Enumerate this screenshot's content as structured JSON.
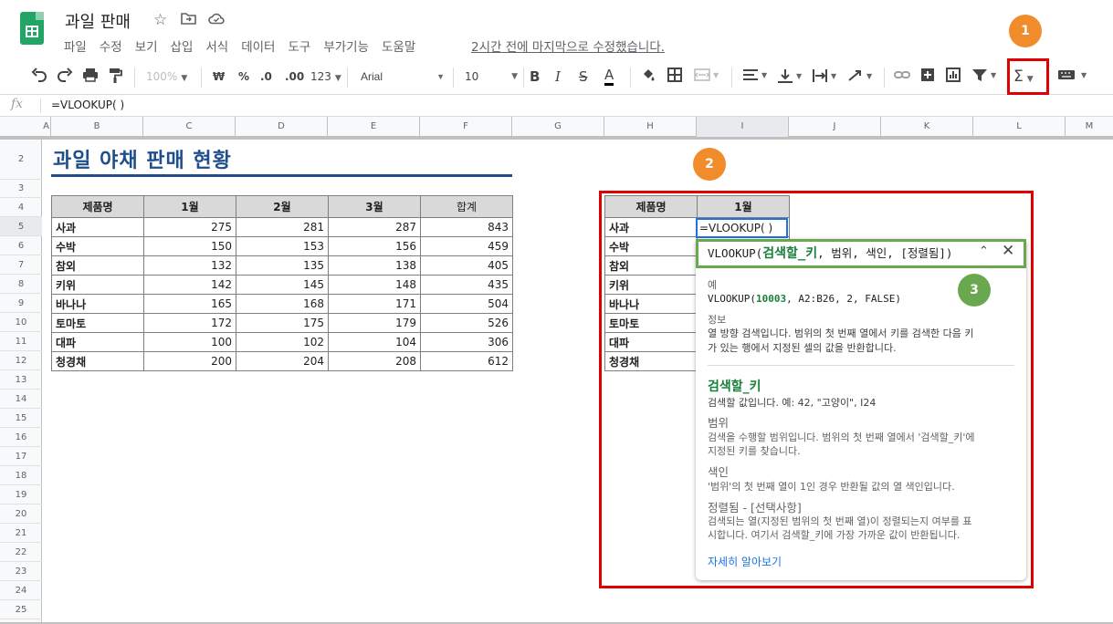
{
  "app": {
    "doc_title": "과일 판매",
    "menu": [
      "파일",
      "수정",
      "보기",
      "삽입",
      "서식",
      "데이터",
      "도구",
      "부가기능",
      "도움말"
    ],
    "last_edit": "2시간 전에 마지막으로 수정했습니다."
  },
  "toolbar": {
    "zoom": "100%",
    "currency": "₩",
    "percent": "%",
    "dec_less": ".0",
    "dec_more": ".00",
    "format_more": "123",
    "font": "Arial",
    "font_size": "10",
    "bold": "B",
    "italic": "I",
    "strike": "S",
    "text_color": "A",
    "functions": "Σ"
  },
  "formula_bar": {
    "fx": "fx",
    "content": "=VLOOKUP( )"
  },
  "columns": [
    "A",
    "B",
    "C",
    "D",
    "E",
    "F",
    "G",
    "H",
    "I",
    "J",
    "K",
    "L",
    "M"
  ],
  "rows": [
    "2",
    "3",
    "4",
    "5",
    "6",
    "7",
    "8",
    "9",
    "10",
    "11",
    "12",
    "13",
    "14",
    "15",
    "16",
    "17",
    "18",
    "19",
    "20",
    "21",
    "22",
    "23",
    "24",
    "25"
  ],
  "sheet_title": "과일 야채 판매 현황",
  "main_table": {
    "headers": [
      "제품명",
      "1월",
      "2월",
      "3월",
      "합계"
    ],
    "rows": [
      [
        "사과",
        "275",
        "281",
        "287",
        "843"
      ],
      [
        "수박",
        "150",
        "153",
        "156",
        "459"
      ],
      [
        "참외",
        "132",
        "135",
        "138",
        "405"
      ],
      [
        "키위",
        "142",
        "145",
        "148",
        "435"
      ],
      [
        "바나나",
        "165",
        "168",
        "171",
        "504"
      ],
      [
        "토마토",
        "172",
        "175",
        "179",
        "526"
      ],
      [
        "대파",
        "100",
        "102",
        "104",
        "306"
      ],
      [
        "청경채",
        "200",
        "204",
        "208",
        "612"
      ]
    ]
  },
  "lookup_table": {
    "headers": [
      "제품명",
      "1월"
    ],
    "names": [
      "사과",
      "수박",
      "참외",
      "키위",
      "바나나",
      "토마토",
      "대파",
      "청경채"
    ],
    "active_cell": "=VLOOKUP( )"
  },
  "badges": {
    "one": "1",
    "two": "2",
    "three": "3"
  },
  "help": {
    "signature_fn": "VLOOKUP(",
    "signature_arg": "검색할_키",
    "signature_rest": ", 범위, 색인, [정렬됨])",
    "example_label": "예",
    "example_pre": "VLOOKUP(",
    "example_key": "10003",
    "example_post": ", A2:B26, 2, FALSE)",
    "info_label": "정보",
    "info_line1": "열 방향 검색입니다. 범위의 첫 번째 열에서 키를 검색한 다음 키",
    "info_line2": "가 있는 행에서 지정된 셀의 값을 반환합니다.",
    "arg1_name": "검색할_키",
    "arg1_desc": "검색할 값입니다. 예: 42, \"고양이\", I24",
    "arg2_name": "범위",
    "arg2_desc1": "검색을 수행할 범위입니다. 범위의 첫 번째 열에서 '검색할_키'에",
    "arg2_desc2": "지정된 키를 찾습니다.",
    "arg3_name": "색인",
    "arg3_desc": "'범위'의 첫 번째 열이 1인 경우 반환될 값의 열 색인입니다.",
    "arg4_name": "정렬됨 - [선택사항]",
    "arg4_desc1": "검색되는 열(지정된 범위의 첫 번째 열)이 정렬되는지 여부를 표",
    "arg4_desc2": "시합니다. 여기서 검색할_키에 가장 가까운 값이 반환됩니다.",
    "learn_more": "자세히 알아보기"
  },
  "colors": {
    "accent": "#1a73e8",
    "highlight": "#e00000",
    "badge_orange": "#f08c2b",
    "badge_green": "#6aa84f",
    "title_blue": "#1f4e8c"
  }
}
